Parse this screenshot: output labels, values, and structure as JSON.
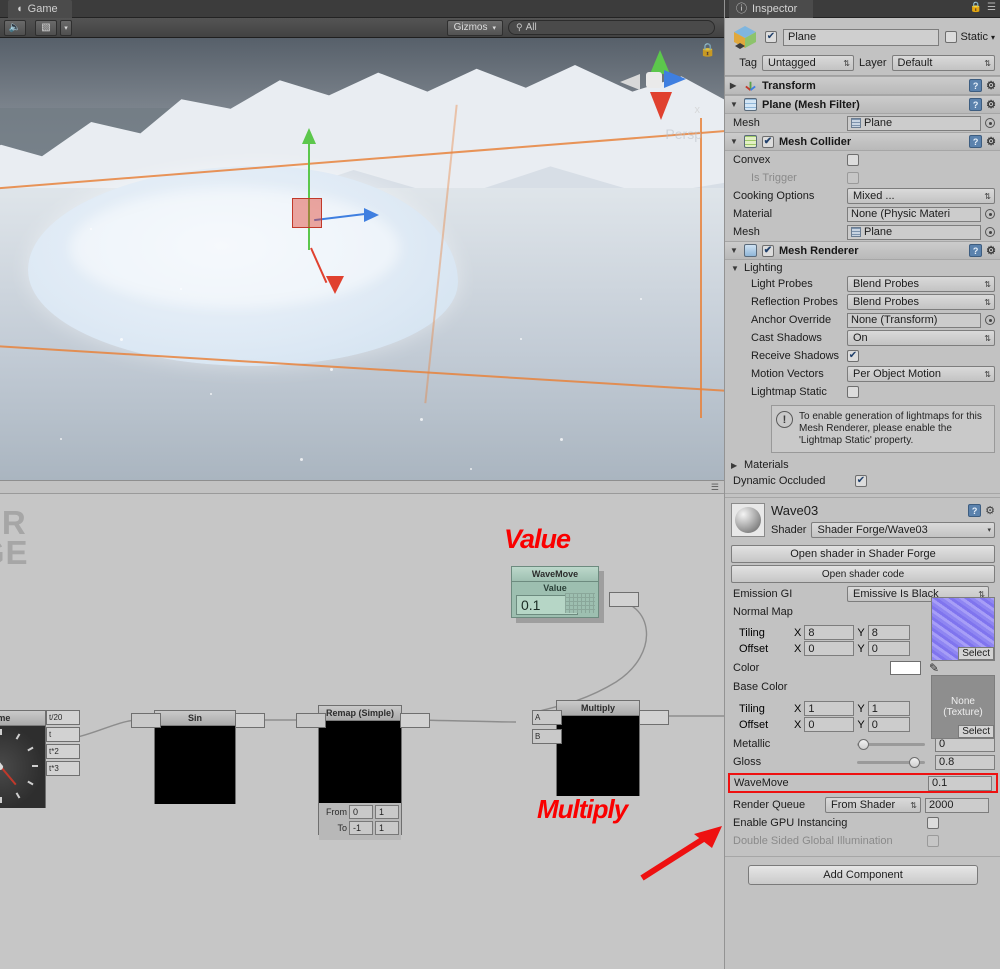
{
  "game_panel": {
    "tab_label": "Game",
    "tab_icon": "game-controller-icon",
    "toolbar": {
      "audio_icon": "speaker-icon",
      "stats_icon": "image-icon",
      "stats_caret": "▾",
      "gizmos_label": "Gizmos",
      "gizmos_caret": "▾",
      "search_icon": "search-icon",
      "search_value": "All",
      "search_placeholder": "All"
    },
    "scene": {
      "lock_icon": "lock-icon",
      "persp_label": "Persp",
      "x_label": "x",
      "gizmo_axes": [
        "y-axis-green",
        "x-axis-red",
        "z-axis-blue"
      ]
    },
    "footer_menu_icon": "panel-menu-icon"
  },
  "shader_forge": {
    "watermark_line1": "DER",
    "watermark_line2": "RGE",
    "annotations": {
      "value": "Value",
      "multiply": "Multiply",
      "arrow": "red-arrow-pointer"
    },
    "nodes": [
      {
        "id": "time",
        "title": "Time",
        "outputs": [
          "t/20",
          "t",
          "t*2",
          "t*3"
        ]
      },
      {
        "id": "sin",
        "title": "Sin",
        "inputs": [
          ""
        ],
        "outputs": [
          ""
        ]
      },
      {
        "id": "remap",
        "title": "Remap (Simple)",
        "inputs": [
          ""
        ],
        "outputs": [
          ""
        ],
        "fields": [
          {
            "label": "From",
            "a": "0",
            "b": "1"
          },
          {
            "label": "To",
            "a": "-1",
            "b": "1"
          }
        ]
      },
      {
        "id": "multiply",
        "title": "Multiply",
        "inputs": [
          "A",
          "B"
        ],
        "outputs": [
          ""
        ]
      },
      {
        "id": "wavemove",
        "title": "WaveMove",
        "subtitle": "Value",
        "value": "0.1",
        "outputs": [
          ""
        ]
      }
    ]
  },
  "inspector": {
    "tab_label": "Inspector",
    "tab_icon": "info-icon",
    "lock_icon": "lock-icon",
    "menu_icon": "panel-menu-icon",
    "gameobject": {
      "icon": "cube-icon",
      "enabled": true,
      "name": "Plane",
      "static_label": "Static",
      "static_checked": false,
      "static_caret": "▾",
      "tag_label": "Tag",
      "tag_value": "Untagged",
      "layer_label": "Layer",
      "layer_value": "Default"
    },
    "components": [
      {
        "name": "Transform",
        "icon": "transform-axis-icon",
        "expanded": false,
        "has_checkbox": false,
        "help_icon": "help-book-icon",
        "gear_icon": "gear-icon"
      },
      {
        "name": "Plane (Mesh Filter)",
        "icon": "mesh-filter-icon",
        "expanded": true,
        "has_checkbox": false,
        "help_icon": "help-book-icon",
        "gear_icon": "gear-icon",
        "rows": [
          {
            "label": "Mesh",
            "type": "object",
            "value": "Plane",
            "value_icon": "mesh-icon"
          }
        ]
      },
      {
        "name": "Mesh Collider",
        "icon": "mesh-collider-icon",
        "expanded": true,
        "has_checkbox": true,
        "checked": true,
        "help_icon": "help-book-icon",
        "gear_icon": "gear-icon",
        "rows": [
          {
            "label": "Convex",
            "type": "check",
            "checked": false
          },
          {
            "label": "Is Trigger",
            "type": "check",
            "checked": false,
            "disabled": true,
            "indent": true
          },
          {
            "label": "Cooking Options",
            "type": "dropdown",
            "value": "Mixed ..."
          },
          {
            "label": "Material",
            "type": "object",
            "value": "None (Physic Materi"
          },
          {
            "label": "Mesh",
            "type": "object",
            "value": "Plane",
            "value_icon": "mesh-icon"
          }
        ]
      },
      {
        "name": "Mesh Renderer",
        "icon": "mesh-renderer-icon",
        "expanded": true,
        "has_checkbox": true,
        "checked": true,
        "help_icon": "help-book-icon",
        "gear_icon": "gear-icon",
        "section_label": "Lighting",
        "rows": [
          {
            "label": "Light Probes",
            "type": "dropdown",
            "value": "Blend Probes"
          },
          {
            "label": "Reflection Probes",
            "type": "dropdown",
            "value": "Blend Probes"
          },
          {
            "label": "Anchor Override",
            "type": "object",
            "value": "None (Transform)"
          },
          {
            "label": "Cast Shadows",
            "type": "dropdown",
            "value": "On"
          },
          {
            "label": "Receive Shadows",
            "type": "check",
            "checked": true
          },
          {
            "label": "Motion Vectors",
            "type": "dropdown",
            "value": "Per Object Motion"
          },
          {
            "label": "Lightmap Static",
            "type": "check",
            "checked": false
          }
        ],
        "helpbox": {
          "icon": "warning-icon",
          "text": "To enable generation of lightmaps for this Mesh Renderer, please enable the 'Lightmap Static' property."
        },
        "materials_label": "Materials",
        "dynamic_occluded_label": "Dynamic Occluded",
        "dynamic_occluded_checked": true
      }
    ],
    "material": {
      "name": "Wave03",
      "preview_icon": "material-sphere-icon",
      "help_icon": "help-book-icon",
      "gear_icon": "gear-icon",
      "shader_label": "Shader",
      "shader_value": "Shader Forge/Wave03",
      "open_in_forge_label": "Open shader in Shader Forge",
      "open_code_label": "Open shader code",
      "emission_gi_label": "Emission GI",
      "emission_gi_value": "Emissive Is Black",
      "normal_map": {
        "label": "Normal Map",
        "select_label": "Select",
        "tiling_label": "Tiling",
        "tiling_x": "8",
        "tiling_y": "8",
        "offset_label": "Offset",
        "offset_x": "0",
        "offset_y": "0"
      },
      "color": {
        "label": "Color",
        "swatch_hex": "#ffffff",
        "eyedropper_icon": "eyedropper-icon"
      },
      "base_color": {
        "label": "Base Color",
        "texture_value": "None\n(Texture)",
        "texture_line1": "None",
        "texture_line2": "(Texture)",
        "select_label": "Select",
        "tiling_label": "Tiling",
        "tiling_x": "1",
        "tiling_y": "1",
        "offset_label": "Offset",
        "offset_x": "0",
        "offset_y": "0"
      },
      "metallic": {
        "label": "Metallic",
        "value": "0",
        "pct": 3
      },
      "gloss": {
        "label": "Gloss",
        "value": "0.8",
        "pct": 80
      },
      "wavemove": {
        "label": "WaveMove",
        "value": "0.1",
        "highlight_hex": "#ee1111"
      },
      "render_queue": {
        "label": "Render Queue",
        "mode": "From Shader",
        "value": "2000"
      },
      "gpu_instancing": {
        "label": "Enable GPU Instancing",
        "checked": false
      },
      "double_sided_gi": {
        "label": "Double Sided Global Illumination",
        "checked": false,
        "disabled": true
      }
    },
    "add_component_label": "Add Component",
    "x_label": "X",
    "y_label": "Y"
  }
}
